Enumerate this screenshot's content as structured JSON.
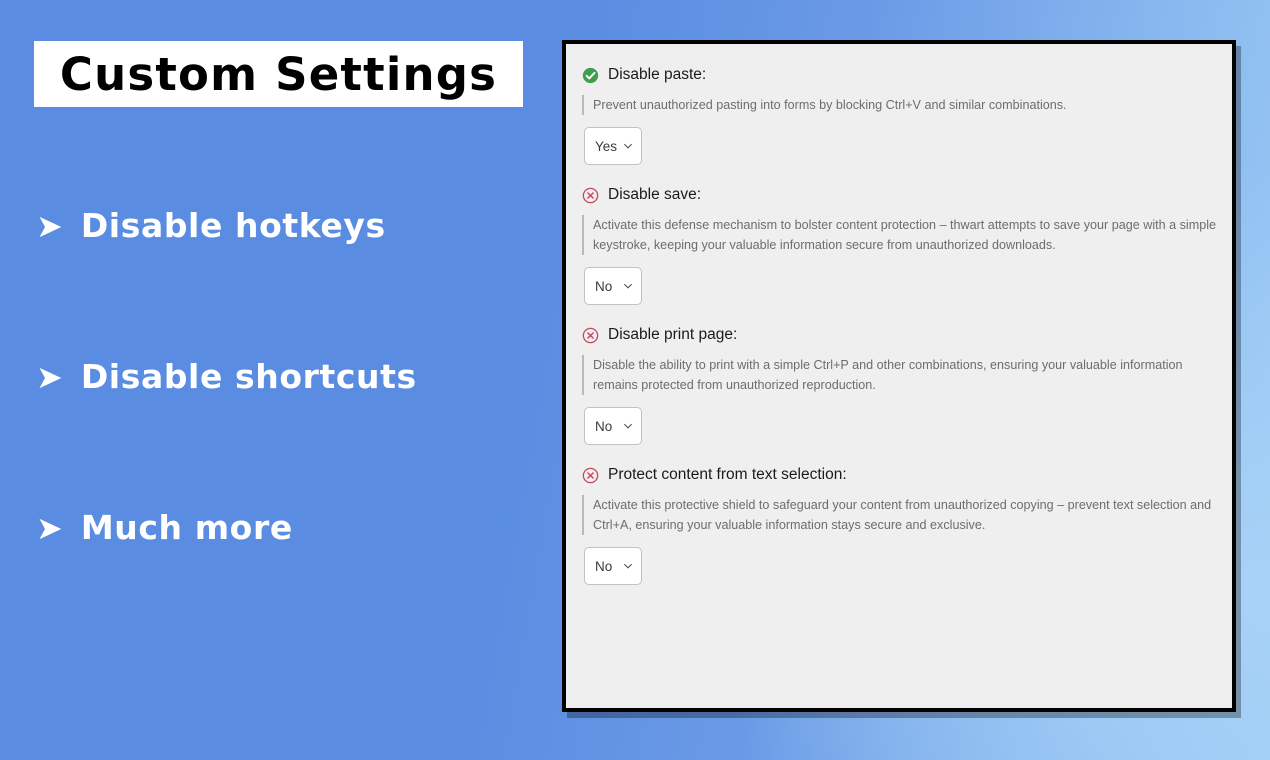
{
  "theme": {
    "background_blue": "#5a8de2",
    "background_blue_light": "#9ccaf5",
    "panel_background": "#efefef",
    "panel_border": "#000000",
    "icon_enabled_color": "#3f9e4d",
    "icon_disabled_color": "#c9435b",
    "title_text_color": "#000000",
    "feature_text_color": "#ffffff"
  },
  "left": {
    "title": "Custom Settings",
    "features": [
      {
        "bullet": "arrow-bullet-icon",
        "glyph": "➤",
        "label": "Disable hotkeys"
      },
      {
        "bullet": "arrow-bullet-icon",
        "glyph": "➤",
        "label": "Disable shortcuts"
      },
      {
        "bullet": "arrow-bullet-icon",
        "glyph": "➤",
        "label": "Much more"
      }
    ]
  },
  "panel": {
    "settings": [
      {
        "id": "disable-paste",
        "status_icon": "check-circle-icon",
        "status": "enabled",
        "title": "Disable paste:",
        "description": "Prevent unauthorized pasting into forms by blocking Ctrl+V and similar combinations.",
        "select_value": "Yes",
        "select_options": [
          "Yes",
          "No"
        ]
      },
      {
        "id": "disable-save",
        "status_icon": "x-circle-icon",
        "status": "disabled",
        "title": "Disable save:",
        "description": "Activate this defense mechanism to bolster content protection – thwart attempts to save your page with a simple keystroke, keeping your valuable information secure from unauthorized downloads.",
        "select_value": "No",
        "select_options": [
          "Yes",
          "No"
        ]
      },
      {
        "id": "disable-print-page",
        "status_icon": "x-circle-icon",
        "status": "disabled",
        "title": "Disable print page:",
        "description": "Disable the ability to print with a simple Ctrl+P and other combinations, ensuring your valuable information remains protected from unauthorized reproduction.",
        "select_value": "No",
        "select_options": [
          "Yes",
          "No"
        ]
      },
      {
        "id": "protect-content-text-selection",
        "status_icon": "x-circle-icon",
        "status": "disabled",
        "title": "Protect content from text selection:",
        "description": "Activate this protective shield to safeguard your content from unauthorized copying – prevent text selection and Ctrl+A, ensuring your valuable information stays secure and exclusive.",
        "select_value": "No",
        "select_options": [
          "Yes",
          "No"
        ]
      }
    ]
  }
}
